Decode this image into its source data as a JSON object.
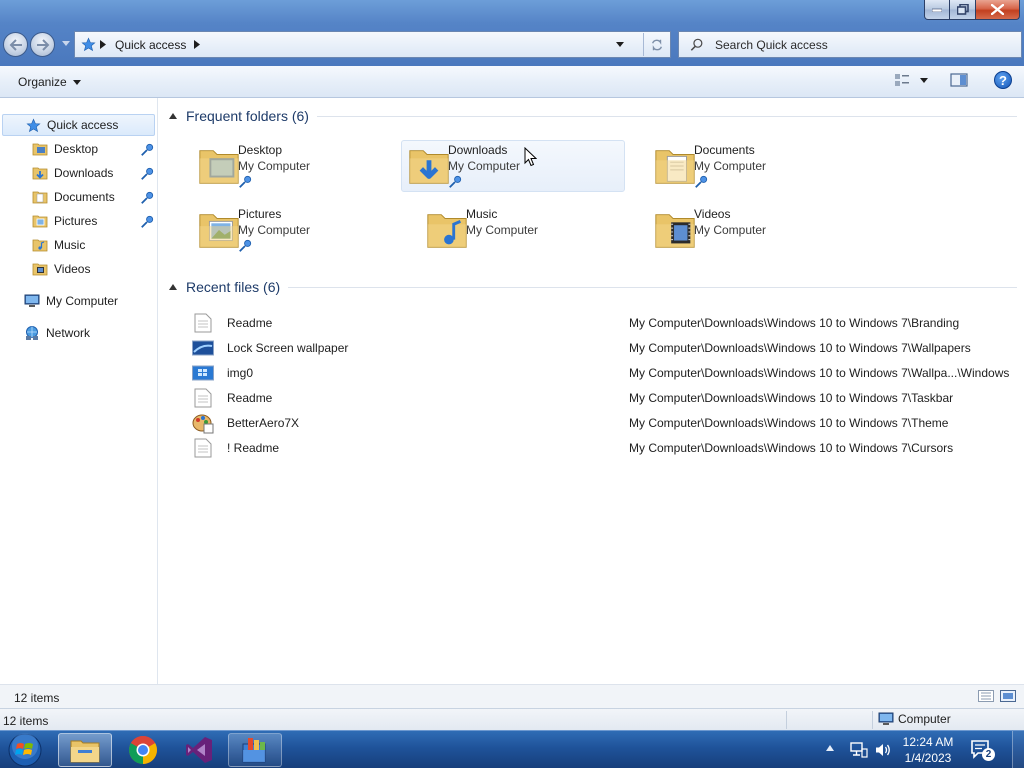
{
  "window": {
    "address": {
      "crumb": "Quick access"
    },
    "search": {
      "placeholder": "Search Quick access"
    }
  },
  "toolbar": {
    "organize_label": "Organize"
  },
  "nav": {
    "quick_access": "Quick access",
    "items": [
      {
        "label": "Desktop",
        "icon": "desktop-folder-icon",
        "pinned": true
      },
      {
        "label": "Downloads",
        "icon": "downloads-folder-icon",
        "pinned": true
      },
      {
        "label": "Documents",
        "icon": "documents-folder-icon",
        "pinned": true
      },
      {
        "label": "Pictures",
        "icon": "pictures-folder-icon",
        "pinned": true
      },
      {
        "label": "Music",
        "icon": "music-folder-icon",
        "pinned": false
      },
      {
        "label": "Videos",
        "icon": "videos-folder-icon",
        "pinned": false
      }
    ],
    "my_computer": "My Computer",
    "network": "Network"
  },
  "content": {
    "frequent": {
      "title": "Frequent folders (6)",
      "folders": [
        {
          "name": "Desktop",
          "location": "My Computer",
          "pinned": true
        },
        {
          "name": "Downloads",
          "location": "My Computer",
          "pinned": true
        },
        {
          "name": "Documents",
          "location": "My Computer",
          "pinned": true
        },
        {
          "name": "Pictures",
          "location": "My Computer",
          "pinned": true
        },
        {
          "name": "Music",
          "location": "My Computer",
          "pinned": false
        },
        {
          "name": "Videos",
          "location": "My Computer",
          "pinned": false
        }
      ]
    },
    "recent": {
      "title": "Recent files (6)",
      "files": [
        {
          "name": "Readme",
          "path": "My Computer\\Downloads\\Windows 10 to Windows 7\\Branding",
          "icon": "text-file-icon"
        },
        {
          "name": "Lock Screen wallpaper",
          "path": "My Computer\\Downloads\\Windows 10 to Windows 7\\Wallpapers",
          "icon": "image-file-icon"
        },
        {
          "name": "img0",
          "path": "My Computer\\Downloads\\Windows 10 to Windows 7\\Wallpa...\\Windows",
          "icon": "image-file-icon"
        },
        {
          "name": "Readme",
          "path": "My Computer\\Downloads\\Windows 10 to Windows 7\\Taskbar",
          "icon": "text-file-icon"
        },
        {
          "name": "BetterAero7X",
          "path": "My Computer\\Downloads\\Windows 10 to Windows 7\\Theme",
          "icon": "theme-file-icon"
        },
        {
          "name": "! Readme",
          "path": "My Computer\\Downloads\\Windows 10 to Windows 7\\Cursors",
          "icon": "text-file-icon"
        }
      ]
    }
  },
  "status": {
    "items_count": "12 items",
    "items_count_bottom": "12 items",
    "zone": "Computer"
  },
  "taskbar": {
    "time": "12:24 AM",
    "date": "1/4/2023",
    "notifications": "2"
  }
}
